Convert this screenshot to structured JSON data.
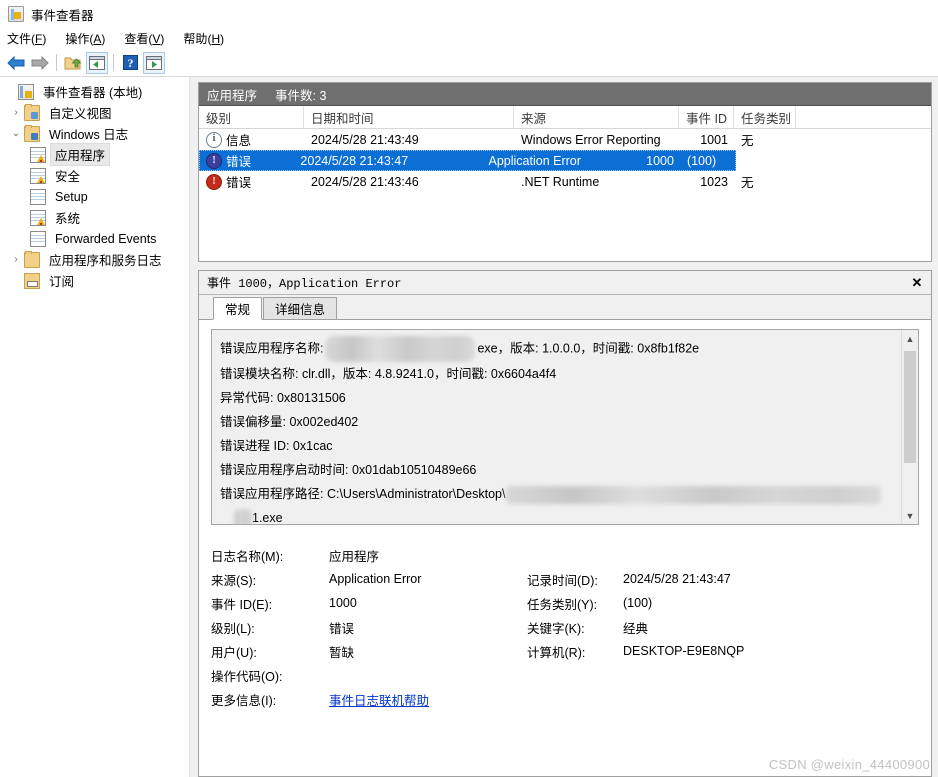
{
  "window": {
    "title": "事件查看器",
    "app_icon": "event-viewer-icon"
  },
  "menubar": [
    {
      "label": "文件",
      "mnemonic": "F"
    },
    {
      "label": "操作",
      "mnemonic": "A"
    },
    {
      "label": "查看",
      "mnemonic": "V"
    },
    {
      "label": "帮助",
      "mnemonic": "H"
    }
  ],
  "toolbar": {
    "buttons": [
      {
        "name": "back-arrow-icon",
        "glyph": "←"
      },
      {
        "name": "forward-arrow-icon",
        "glyph": "→"
      },
      {
        "name": "up-folder-icon",
        "glyph": ""
      },
      {
        "name": "show-tree-pane-icon",
        "glyph": ""
      },
      {
        "name": "help-icon",
        "glyph": "?"
      },
      {
        "name": "show-action-pane-icon",
        "glyph": ""
      }
    ]
  },
  "tree": {
    "items": [
      {
        "label": "事件查看器 (本地)",
        "icon": "event-viewer-icon",
        "indent": 0,
        "chevron": "",
        "selected": false
      },
      {
        "label": "自定义视图",
        "icon": "folder-icon",
        "indent": 1,
        "chevron": "›",
        "selected": false
      },
      {
        "label": "Windows 日志",
        "icon": "folder-monitor-icon",
        "indent": 1,
        "chevron": "⌄",
        "selected": false
      },
      {
        "label": "应用程序",
        "icon": "log-warning-icon",
        "indent": 2,
        "chevron": "",
        "selected": true
      },
      {
        "label": "安全",
        "icon": "log-warning-icon",
        "indent": 2,
        "chevron": "",
        "selected": false
      },
      {
        "label": "Setup",
        "icon": "log-icon",
        "indent": 2,
        "chevron": "",
        "selected": false
      },
      {
        "label": "系统",
        "icon": "log-warning-icon",
        "indent": 2,
        "chevron": "",
        "selected": false
      },
      {
        "label": "Forwarded Events",
        "icon": "log-icon",
        "indent": 2,
        "chevron": "",
        "selected": false
      },
      {
        "label": "应用程序和服务日志",
        "icon": "folder-plain-icon",
        "indent": 1,
        "chevron": "›",
        "selected": false
      },
      {
        "label": "订阅",
        "icon": "subscription-icon",
        "indent": 1,
        "chevron": "",
        "selected": false
      }
    ]
  },
  "list": {
    "banner_title": "应用程序",
    "banner_count": "事件数: 3",
    "columns": [
      "级别",
      "日期和时间",
      "来源",
      "事件 ID",
      "任务类别"
    ],
    "rows": [
      {
        "icon": "info-icon",
        "icon_glyph": "i",
        "level": "信息",
        "datetime": "2024/5/28 21:43:49",
        "source": "Windows Error Reporting",
        "event_id": "1001",
        "task_category": "无",
        "selected": false
      },
      {
        "icon": "error-icon",
        "icon_glyph": "!",
        "level": "错误",
        "datetime": "2024/5/28 21:43:47",
        "source": "Application Error",
        "event_id": "1000",
        "task_category": "(100)",
        "selected": true
      },
      {
        "icon": "error-icon",
        "icon_glyph": "!",
        "level": "错误",
        "datetime": "2024/5/28 21:43:46",
        "source": ".NET Runtime",
        "event_id": "1023",
        "task_category": "无",
        "selected": false
      }
    ]
  },
  "detail": {
    "title_prefix": "事件 1000",
    "title_sep": "，",
    "title_source": "Application Error",
    "close_label": "✕",
    "tabs": [
      {
        "label": "常规",
        "active": true
      },
      {
        "label": "详细信息",
        "active": false
      }
    ],
    "message": {
      "line1_a": "错误应用程序名称:",
      "line1_b": "exe，版本: 1.0.0.0，时间戳: 0x8fb1f82e",
      "line2": "错误模块名称: clr.dll，版本: 4.8.9241.0，时间戳: 0x6604a4f4",
      "line3": "异常代码: 0x80131506",
      "line4": "错误偏移量: 0x002ed402",
      "line5": "错误进程 ID: 0x1cac",
      "line6": "错误应用程序启动时间: 0x01dab10510489e66",
      "line7_a": "错误应用程序路径: C:\\Users\\Administrator\\Desktop\\",
      "line8": "1.exe"
    },
    "scrollbar": {
      "up_glyph": "▲",
      "down_glyph": "▼"
    },
    "fields": {
      "log_name_label": "日志名称(M):",
      "log_name_value": "应用程序",
      "source_label": "来源(S):",
      "source_value": "Application Error",
      "logged_label": "记录时间(D):",
      "logged_value": "2024/5/28 21:43:47",
      "event_id_label": "事件 ID(E):",
      "event_id_value": "1000",
      "task_category_label": "任务类别(Y):",
      "task_category_value": "(100)",
      "level_label": "级别(L):",
      "level_value": "错误",
      "keywords_label": "关键字(K):",
      "keywords_value": "经典",
      "user_label": "用户(U):",
      "user_value": "暂缺",
      "computer_label": "计算机(R):",
      "computer_value": "DESKTOP-E9E8NQP",
      "opcode_label": "操作代码(O):",
      "opcode_value": "",
      "more_info_label": "更多信息(I):",
      "more_info_link": "事件日志联机帮助"
    }
  },
  "watermark": "CSDN @weixin_44400900",
  "colors": {
    "selection_blue": "#0b6fd6",
    "banner_gray": "#6f6f6f",
    "error_red": "#c42b1c",
    "link_blue": "#0033cc",
    "pane_bg": "#f0f0f0"
  }
}
